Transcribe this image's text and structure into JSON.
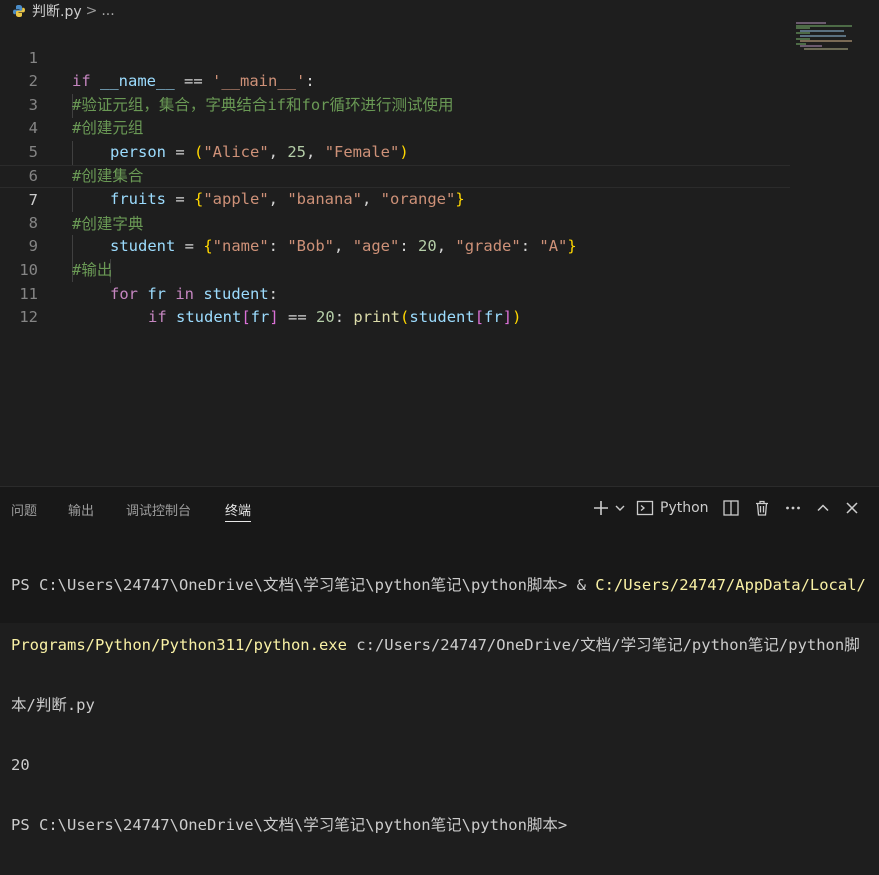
{
  "breadcrumb": {
    "file": "判断.py",
    "separator": ">",
    "more": "..."
  },
  "editor": {
    "lines": [
      {
        "n": "1"
      },
      {
        "n": "2"
      },
      {
        "n": "3"
      },
      {
        "n": "4"
      },
      {
        "n": "5"
      },
      {
        "n": "6"
      },
      {
        "n": "7"
      },
      {
        "n": "8"
      },
      {
        "n": "9"
      },
      {
        "n": "10"
      },
      {
        "n": "11"
      },
      {
        "n": "12"
      }
    ],
    "current_line": 7,
    "code": {
      "l1": {
        "kw": "if",
        "name": "__name__",
        "op": " == ",
        "str": "'__main__'",
        "colon": ":"
      },
      "l2": {
        "comment": "#验证元组，集合，字典结合if和for循环进行测试使用"
      },
      "l3": {
        "comment": "#创建元组"
      },
      "l4": {
        "var": "person",
        "op": " = ",
        "open": "(",
        "s1": "\"Alice\"",
        "c1": ", ",
        "n1": "25",
        "c2": ", ",
        "s2": "\"Female\"",
        "close": ")"
      },
      "l5": {
        "comment": "#创建集合"
      },
      "l6": {
        "var": "fruits",
        "op": " = ",
        "open": "{",
        "s1": "\"apple\"",
        "c1": ", ",
        "s2": "\"banana\"",
        "c2": ", ",
        "s3": "\"orange\"",
        "close": "}"
      },
      "l7": {
        "comment": "#创建字典"
      },
      "l8": {
        "var": "student",
        "op": " = ",
        "open": "{",
        "k1": "\"name\"",
        "col1": ": ",
        "v1": "\"Bob\"",
        "c1": ", ",
        "k2": "\"age\"",
        "col2": ": ",
        "v2": "20",
        "c2": ", ",
        "k3": "\"grade\"",
        "col3": ": ",
        "v3": "\"A\"",
        "close": "}"
      },
      "l9": {
        "comment": "#输出"
      },
      "l10": {
        "kw": "for",
        "var1": " fr ",
        "kw2": "in",
        "var2": " student",
        "colon": ":"
      },
      "l11": {
        "kw": "if",
        "var": " student",
        "ob": "[",
        "idx": "fr",
        "cb": "]",
        "op": " == ",
        "num": "20",
        "colon": ": ",
        "fn": "print",
        "po": "(",
        "arg": "student",
        "ob2": "[",
        "idx2": "fr",
        "cb2": "]",
        "pc": ")"
      }
    }
  },
  "panel": {
    "tabs": [
      "问题",
      "输出",
      "调试控制台",
      "终端"
    ],
    "active_tab": "终端",
    "terminal_profile": "Python",
    "icons": [
      "plus-icon",
      "chevron-down-icon",
      "terminal-icon",
      "split-icon",
      "trash-icon",
      "more-icon",
      "chevron-up-icon",
      "close-icon"
    ]
  },
  "terminal": {
    "prompt1": "PS C:\\Users\\24747\\OneDrive\\文档\\学习笔记\\python笔记\\python脚本> & ",
    "cmd_line1": "C:/Users/24747/AppData/Local/",
    "cmd_line2": "Programs/Python/Python311/python.exe",
    "args_line2": " c:/Users/24747/OneDrive/文档/学习笔记/python笔记/python脚",
    "args_line3": "本/判断.py",
    "output": "20",
    "prompt2": "PS C:\\Users\\24747\\OneDrive\\文档\\学习笔记\\python笔记\\python脚本>"
  },
  "colors": {
    "background": "#1e1e1e",
    "keyword": "#c586c0",
    "variable": "#9cdcfe",
    "string": "#ce9178",
    "number": "#b5cea8",
    "comment": "#6a9955",
    "function": "#dcdcaa",
    "terminal_command": "#f9f1a5"
  }
}
